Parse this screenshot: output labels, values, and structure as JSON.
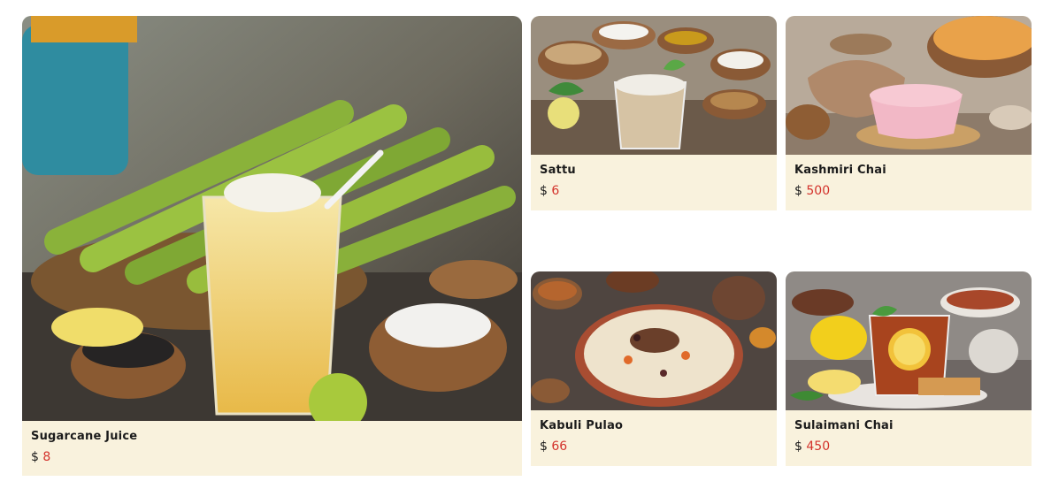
{
  "menu": {
    "currency": "$",
    "items": [
      {
        "name": "Sugarcane Juice",
        "price": "8"
      },
      {
        "name": "Sattu",
        "price": "6"
      },
      {
        "name": "Kashmiri Chai",
        "price": "500"
      },
      {
        "name": "Kabuli Pulao",
        "price": "66"
      },
      {
        "name": "Sulaimani Chai",
        "price": "450"
      }
    ]
  },
  "colors": {
    "card_background": "#f9f2dd",
    "price_value": "#d3322b",
    "text": "#1b1b1b"
  }
}
